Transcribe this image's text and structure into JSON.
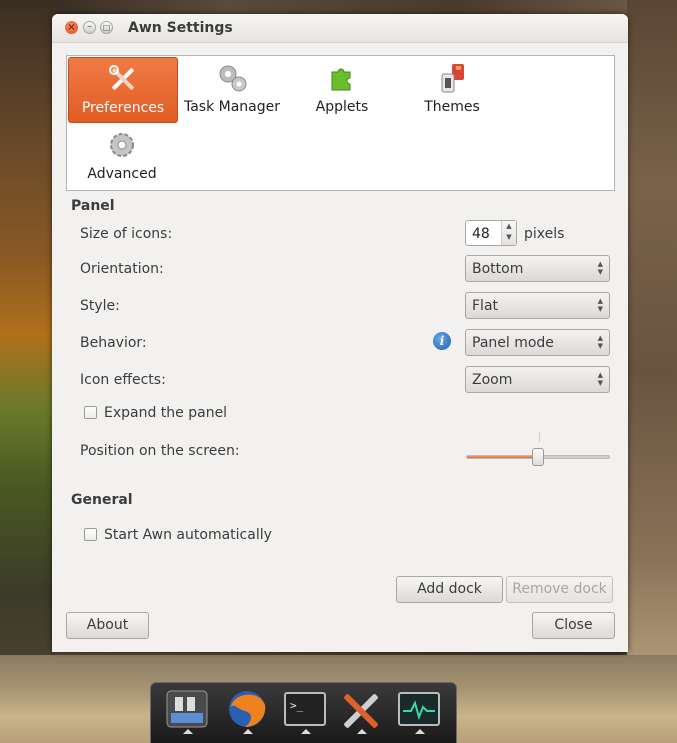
{
  "window": {
    "title": "Awn Settings",
    "controls": {
      "close": "×",
      "minimize": "–",
      "maximize": "□"
    }
  },
  "tabs": [
    {
      "label": "Preferences",
      "icon": "tools-icon",
      "selected": true
    },
    {
      "label": "Task Manager",
      "icon": "gears-icon",
      "selected": false
    },
    {
      "label": "Applets",
      "icon": "puzzle-icon",
      "selected": false
    },
    {
      "label": "Themes",
      "icon": "themes-icon",
      "selected": false
    },
    {
      "label": "Advanced",
      "icon": "gear-icon",
      "selected": false
    }
  ],
  "panel": {
    "title": "Panel",
    "size_label": "Size of icons:",
    "size_value": "48",
    "size_unit": "pixels",
    "orientation_label": "Orientation:",
    "orientation_value": "Bottom",
    "style_label": "Style:",
    "style_value": "Flat",
    "behavior_label": "Behavior:",
    "behavior_value": "Panel mode",
    "icon_effects_label": "Icon effects:",
    "icon_effects_value": "Zoom",
    "expand_label": "Expand the panel",
    "expand_checked": false,
    "position_label": "Position on the screen:",
    "position_value": 0.5
  },
  "general": {
    "title": "General",
    "autostart_label": "Start Awn automatically",
    "autostart_checked": false
  },
  "buttons": {
    "add_dock": "Add dock",
    "remove_dock": "Remove dock",
    "about": "About",
    "close": "Close"
  },
  "dock": {
    "items": [
      "awn-settings-icon",
      "firefox-icon",
      "terminal-icon",
      "tools-icon",
      "system-monitor-icon"
    ]
  },
  "colors": {
    "accent": "#e0602a",
    "info": "#1f5fae"
  }
}
